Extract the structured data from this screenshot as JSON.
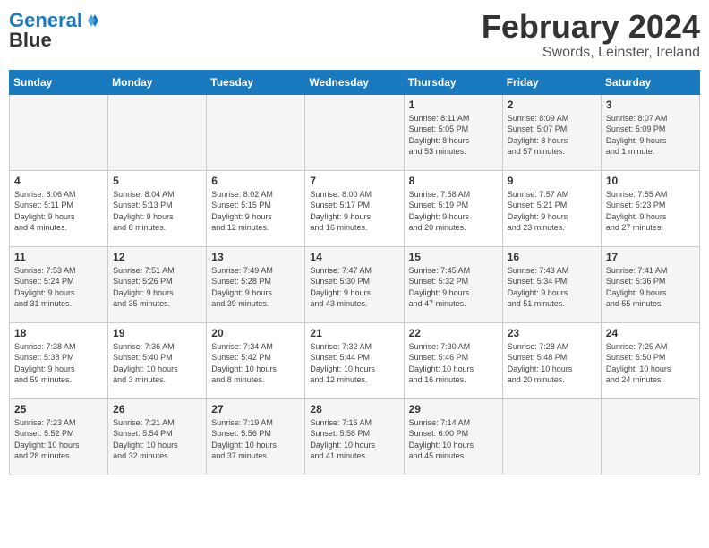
{
  "header": {
    "logo_line1": "General",
    "logo_line2": "Blue",
    "month_year": "February 2024",
    "location": "Swords, Leinster, Ireland"
  },
  "days_of_week": [
    "Sunday",
    "Monday",
    "Tuesday",
    "Wednesday",
    "Thursday",
    "Friday",
    "Saturday"
  ],
  "weeks": [
    [
      {
        "day": "",
        "info": ""
      },
      {
        "day": "",
        "info": ""
      },
      {
        "day": "",
        "info": ""
      },
      {
        "day": "",
        "info": ""
      },
      {
        "day": "1",
        "info": "Sunrise: 8:11 AM\nSunset: 5:05 PM\nDaylight: 8 hours\nand 53 minutes."
      },
      {
        "day": "2",
        "info": "Sunrise: 8:09 AM\nSunset: 5:07 PM\nDaylight: 8 hours\nand 57 minutes."
      },
      {
        "day": "3",
        "info": "Sunrise: 8:07 AM\nSunset: 5:09 PM\nDaylight: 9 hours\nand 1 minute."
      }
    ],
    [
      {
        "day": "4",
        "info": "Sunrise: 8:06 AM\nSunset: 5:11 PM\nDaylight: 9 hours\nand 4 minutes."
      },
      {
        "day": "5",
        "info": "Sunrise: 8:04 AM\nSunset: 5:13 PM\nDaylight: 9 hours\nand 8 minutes."
      },
      {
        "day": "6",
        "info": "Sunrise: 8:02 AM\nSunset: 5:15 PM\nDaylight: 9 hours\nand 12 minutes."
      },
      {
        "day": "7",
        "info": "Sunrise: 8:00 AM\nSunset: 5:17 PM\nDaylight: 9 hours\nand 16 minutes."
      },
      {
        "day": "8",
        "info": "Sunrise: 7:58 AM\nSunset: 5:19 PM\nDaylight: 9 hours\nand 20 minutes."
      },
      {
        "day": "9",
        "info": "Sunrise: 7:57 AM\nSunset: 5:21 PM\nDaylight: 9 hours\nand 23 minutes."
      },
      {
        "day": "10",
        "info": "Sunrise: 7:55 AM\nSunset: 5:23 PM\nDaylight: 9 hours\nand 27 minutes."
      }
    ],
    [
      {
        "day": "11",
        "info": "Sunrise: 7:53 AM\nSunset: 5:24 PM\nDaylight: 9 hours\nand 31 minutes."
      },
      {
        "day": "12",
        "info": "Sunrise: 7:51 AM\nSunset: 5:26 PM\nDaylight: 9 hours\nand 35 minutes."
      },
      {
        "day": "13",
        "info": "Sunrise: 7:49 AM\nSunset: 5:28 PM\nDaylight: 9 hours\nand 39 minutes."
      },
      {
        "day": "14",
        "info": "Sunrise: 7:47 AM\nSunset: 5:30 PM\nDaylight: 9 hours\nand 43 minutes."
      },
      {
        "day": "15",
        "info": "Sunrise: 7:45 AM\nSunset: 5:32 PM\nDaylight: 9 hours\nand 47 minutes."
      },
      {
        "day": "16",
        "info": "Sunrise: 7:43 AM\nSunset: 5:34 PM\nDaylight: 9 hours\nand 51 minutes."
      },
      {
        "day": "17",
        "info": "Sunrise: 7:41 AM\nSunset: 5:36 PM\nDaylight: 9 hours\nand 55 minutes."
      }
    ],
    [
      {
        "day": "18",
        "info": "Sunrise: 7:38 AM\nSunset: 5:38 PM\nDaylight: 9 hours\nand 59 minutes."
      },
      {
        "day": "19",
        "info": "Sunrise: 7:36 AM\nSunset: 5:40 PM\nDaylight: 10 hours\nand 3 minutes."
      },
      {
        "day": "20",
        "info": "Sunrise: 7:34 AM\nSunset: 5:42 PM\nDaylight: 10 hours\nand 8 minutes."
      },
      {
        "day": "21",
        "info": "Sunrise: 7:32 AM\nSunset: 5:44 PM\nDaylight: 10 hours\nand 12 minutes."
      },
      {
        "day": "22",
        "info": "Sunrise: 7:30 AM\nSunset: 5:46 PM\nDaylight: 10 hours\nand 16 minutes."
      },
      {
        "day": "23",
        "info": "Sunrise: 7:28 AM\nSunset: 5:48 PM\nDaylight: 10 hours\nand 20 minutes."
      },
      {
        "day": "24",
        "info": "Sunrise: 7:25 AM\nSunset: 5:50 PM\nDaylight: 10 hours\nand 24 minutes."
      }
    ],
    [
      {
        "day": "25",
        "info": "Sunrise: 7:23 AM\nSunset: 5:52 PM\nDaylight: 10 hours\nand 28 minutes."
      },
      {
        "day": "26",
        "info": "Sunrise: 7:21 AM\nSunset: 5:54 PM\nDaylight: 10 hours\nand 32 minutes."
      },
      {
        "day": "27",
        "info": "Sunrise: 7:19 AM\nSunset: 5:56 PM\nDaylight: 10 hours\nand 37 minutes."
      },
      {
        "day": "28",
        "info": "Sunrise: 7:16 AM\nSunset: 5:58 PM\nDaylight: 10 hours\nand 41 minutes."
      },
      {
        "day": "29",
        "info": "Sunrise: 7:14 AM\nSunset: 6:00 PM\nDaylight: 10 hours\nand 45 minutes."
      },
      {
        "day": "",
        "info": ""
      },
      {
        "day": "",
        "info": ""
      }
    ]
  ]
}
